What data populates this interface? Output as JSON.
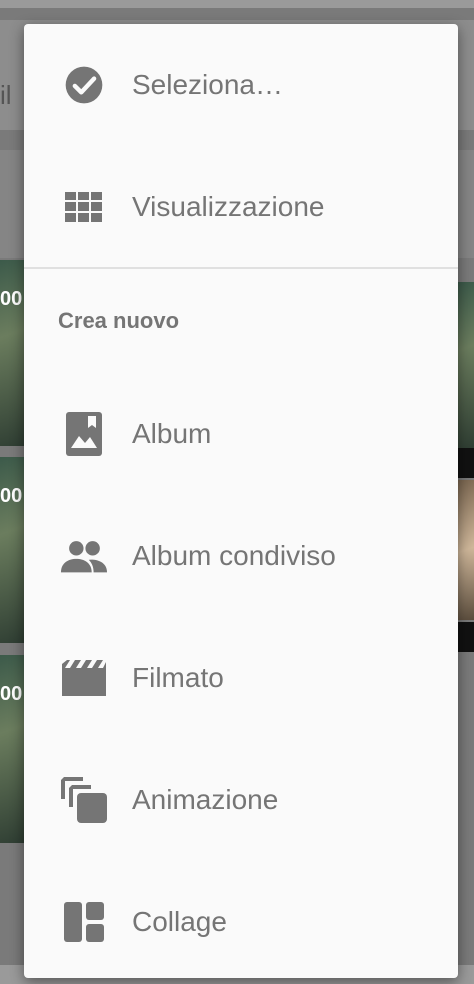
{
  "background": {
    "search_fragment": "il",
    "thumb_labels": [
      "00",
      "00",
      "00"
    ]
  },
  "menu": {
    "items_top": [
      {
        "label": "Seleziona…",
        "icon": "check-circle-icon"
      },
      {
        "label": "Visualizzazione",
        "icon": "grid-view-icon"
      }
    ],
    "section_title": "Crea nuovo",
    "create_items": [
      {
        "label": "Album",
        "icon": "photo-album-icon"
      },
      {
        "label": "Album condiviso",
        "icon": "people-icon"
      },
      {
        "label": "Filmato",
        "icon": "movie-clapper-icon"
      },
      {
        "label": "Animazione",
        "icon": "animation-stack-icon"
      },
      {
        "label": "Collage",
        "icon": "collage-icon"
      }
    ]
  },
  "colors": {
    "icon": "#757575",
    "text": "#757575",
    "menu_bg": "#fafafa",
    "divider": "#e0e0e0"
  }
}
